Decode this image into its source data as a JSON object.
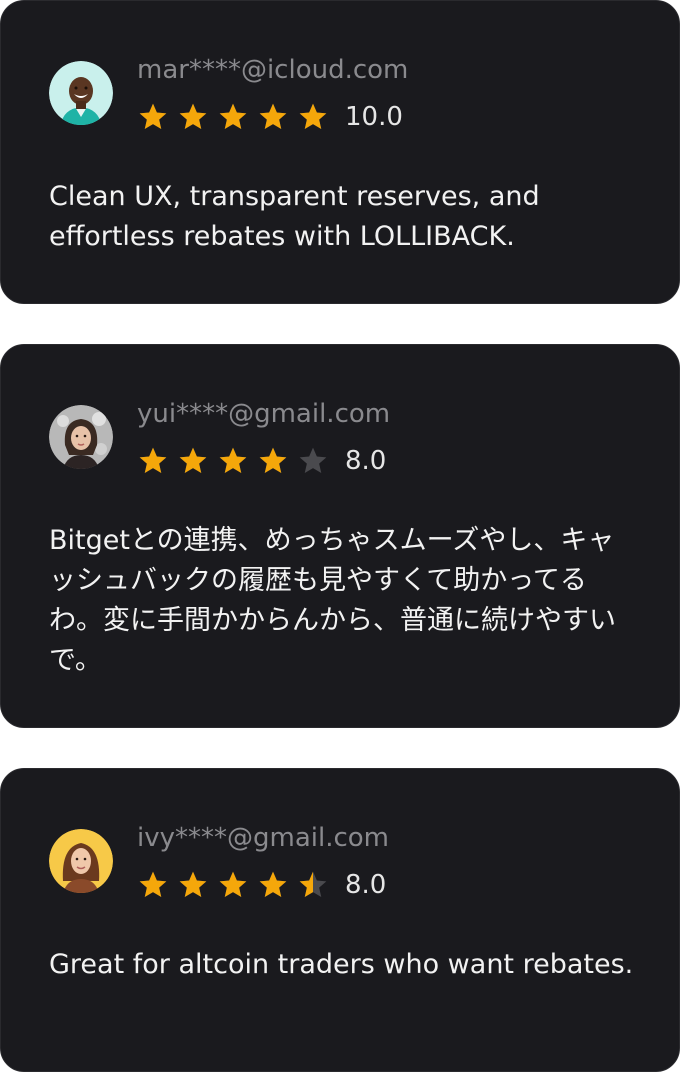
{
  "colors": {
    "card_background": "#1a1a1e",
    "star_filled": "#f5a70a",
    "star_empty": "#4a4a4e",
    "email_text": "#8a8a8e",
    "review_text": "#f2f2f2"
  },
  "reviews": [
    {
      "email": "mar****@icloud.com",
      "rating_stars": 5,
      "score": "10.0",
      "text": "Clean UX, transparent reserves, and effortless rebates with LOLLIBACK.",
      "avatar_icon": "smiling-man-avatar"
    },
    {
      "email": "yui****@gmail.com",
      "rating_stars": 4,
      "score": "8.0",
      "text": "Bitgetとの連携、めっちゃスムーズやし、キャッシュバックの履歴も見やすくて助かってるわ。変に手間かからんから、普通に続けやすいで。",
      "avatar_icon": "woman-avatar"
    },
    {
      "email": "ivy****@gmail.com",
      "rating_stars": 4.5,
      "score": "8.0",
      "text": "Great for altcoin traders who want rebates.",
      "avatar_icon": "woman-avatar-yellow-background"
    }
  ]
}
